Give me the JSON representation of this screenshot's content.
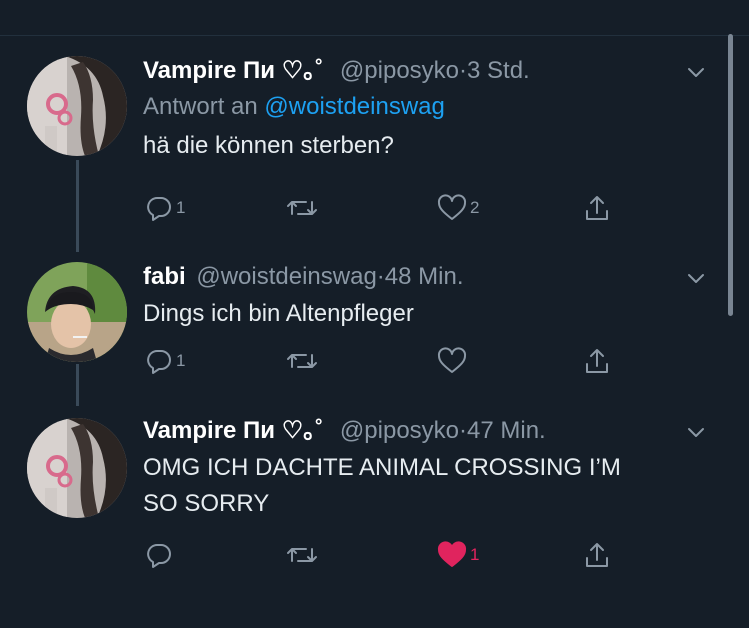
{
  "tweets": [
    {
      "name": "Vampire Пи",
      "name_suffix": "♡｡˚",
      "handle": "@piposyko",
      "time": "3 Std.",
      "reply_to_label": "Antwort an",
      "reply_to_handle": "@woistdeinswag",
      "text": "hä die können sterben?",
      "reply_count": "1",
      "retweet_count": "",
      "like_count": "2",
      "liked": false
    },
    {
      "name": "fabi",
      "name_suffix": "",
      "handle": "@woistdeinswag",
      "time": "48 Min.",
      "text": "Dings ich bin Altenpfleger",
      "reply_count": "1",
      "retweet_count": "",
      "like_count": "",
      "liked": false
    },
    {
      "name": "Vampire Пи",
      "name_suffix": "♡｡˚",
      "handle": "@piposyko",
      "time": "47 Min.",
      "text_line1": "OMG ICH DACHTE ANIMAL CROSSING I’M",
      "text_line2": "SO SORRY",
      "reply_count": "",
      "retweet_count": "",
      "like_count": "1",
      "liked": true
    }
  ],
  "separator": "·",
  "colors": {
    "background": "#151e28",
    "text": "#e6ecf0",
    "secondary": "#8b98a5",
    "link": "#1da1f2",
    "like": "#e0245e"
  },
  "icons": [
    "reply-icon",
    "retweet-icon",
    "like-icon",
    "share-icon",
    "chevron-down-icon"
  ]
}
